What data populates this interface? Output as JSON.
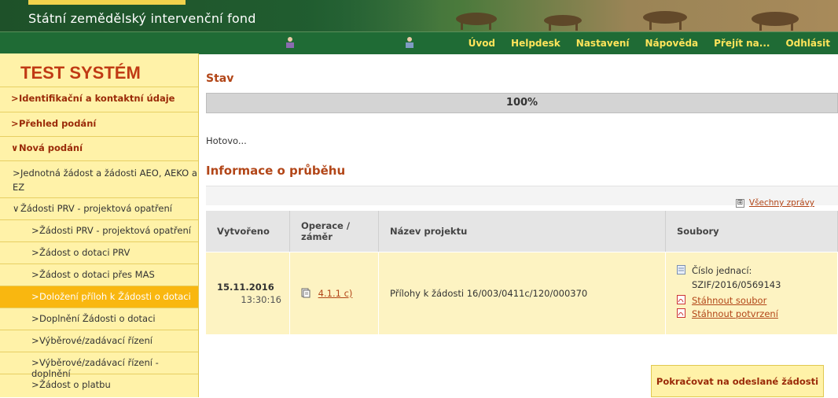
{
  "header": {
    "org_name": "Státní zemědělský intervenční fond",
    "menu": [
      "Úvod",
      "Helpdesk",
      "Nastavení",
      "Nápověda",
      "Přejít na...",
      "Odhlásit"
    ],
    "colors": {
      "menu_bar": "#1f6b35",
      "menu_text": "#ffe45a"
    },
    "icons": [
      "user-icon",
      "user-icon"
    ]
  },
  "sidebar": {
    "system_title": "TEST SYSTÉM",
    "items": [
      {
        "label": "Identifikační a kontaktní údaje",
        "caret": ">"
      },
      {
        "label": "Přehled podání",
        "caret": ">"
      },
      {
        "label": "Nová podání",
        "caret": "∨"
      }
    ],
    "sub_items": [
      {
        "label": "Jednotná žádost a žádosti AEO, AEKO a EZ",
        "caret": ">"
      },
      {
        "label": "Žádosti PRV - projektová opatření",
        "caret": "∨"
      }
    ],
    "leaf_items": [
      {
        "label": "Žádosti PRV - projektová opatření",
        "caret": ">"
      },
      {
        "label": "Žádost o dotaci PRV",
        "caret": ">"
      },
      {
        "label": "Žádost o dotaci přes MAS",
        "caret": ">"
      },
      {
        "label": "Doložení příloh k Žádosti o dotaci",
        "caret": ">"
      },
      {
        "label": "Doplnění Žádosti o dotaci",
        "caret": ">"
      },
      {
        "label": "Výběrové/zadávací řízení",
        "caret": ">"
      },
      {
        "label": "Výběrové/zadávací řízení - doplnění",
        "caret": ">"
      },
      {
        "label": "Žádost o platbu",
        "caret": ">"
      }
    ],
    "colors": {
      "background": "#fff2a8",
      "active": "#f9b710",
      "title": "#c03a14"
    }
  },
  "main": {
    "status_heading": "Stav",
    "progress": {
      "percent": 100,
      "label": "100%"
    },
    "status_text": "Hotovo...",
    "info_heading": "Informace o průběhu",
    "all_messages": "Všechny zprávy",
    "expand_icon": "⊞",
    "table": {
      "headers": {
        "created": "Vytvořeno",
        "operation": "Operace / záměr",
        "project": "Název projektu",
        "files": "Soubory"
      },
      "row": {
        "date": "15.11.2016",
        "time": "13:30:16",
        "operation": "4.1.1 c)",
        "project": "Přílohy k žádosti 16/003/0411c/120/000370",
        "ref_label": "Číslo jednací:",
        "ref_value": "SZIF/2016/0569143",
        "download_file": "Stáhnout soubor",
        "download_confirmation": "Stáhnout potvrzení"
      }
    },
    "continue_button": "Pokračovat na odeslané žádosti"
  }
}
